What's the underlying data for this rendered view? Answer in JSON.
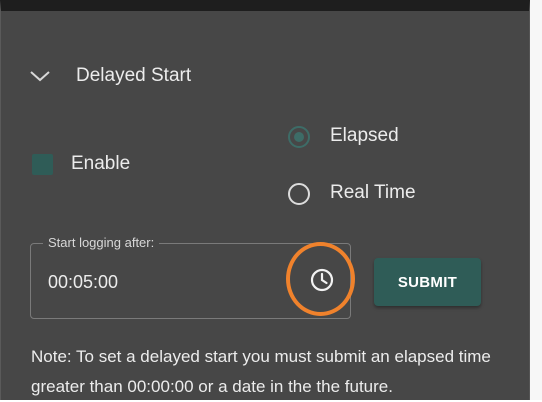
{
  "section": {
    "title": "Delayed Start",
    "expanded": true
  },
  "enable": {
    "label": "Enable",
    "checked": true
  },
  "mode": {
    "options": [
      {
        "label": "Elapsed",
        "selected": true
      },
      {
        "label": "Real Time",
        "selected": false
      }
    ]
  },
  "start_field": {
    "label": "Start logging after:",
    "value": "00:05:00"
  },
  "submit": {
    "label": "SUBMIT"
  },
  "note": {
    "text": "Note: To set a delayed start you must submit an elapsed time greater than 00:00:00 or a date in the the future."
  },
  "colors": {
    "panel_bg": "#474747",
    "accent": "#2f5c57",
    "highlight": "#f0822c",
    "text": "#ececec"
  },
  "icons": {
    "chevron": "chevron-down-icon",
    "clock": "clock-icon"
  }
}
